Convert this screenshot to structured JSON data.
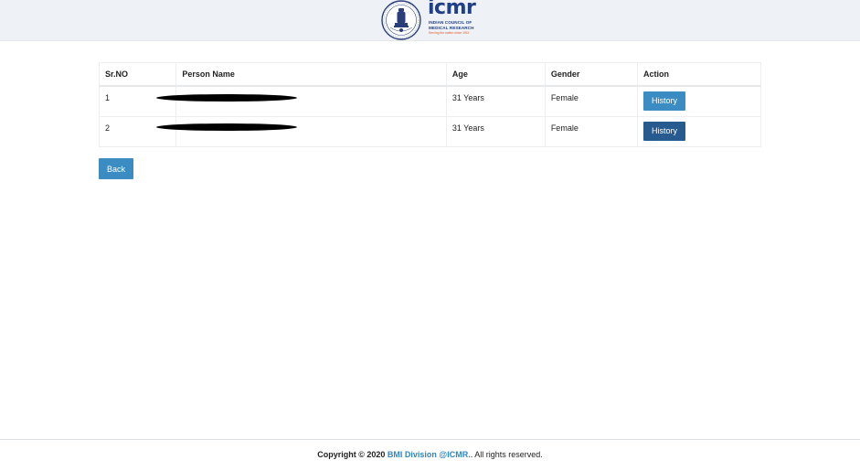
{
  "header": {
    "brand": "icmr",
    "brand_line1": "INDIAN COUNCIL OF",
    "brand_line2": "MEDICAL RESEARCH",
    "tagline": "Serving the nation since 1911",
    "emblem_icon": "icmr-emblem-icon"
  },
  "table": {
    "columns": [
      "Sr.NO",
      "Person Name",
      "Age",
      "Gender",
      "Action"
    ],
    "rows": [
      {
        "sr": "1",
        "name": "",
        "age": "31 Years",
        "gender": "Female",
        "action": "History"
      },
      {
        "sr": "2",
        "name": "",
        "age": "31 Years",
        "gender": "Female",
        "action": "History"
      }
    ]
  },
  "buttons": {
    "back": "Back"
  },
  "footer": {
    "prefix": "Copyright © 2020 ",
    "link": "BMI Division @ICMR.",
    "suffix": ". All rights reserved."
  },
  "colors": {
    "header_bg": "#eef1f5",
    "primary_button": "#3a8cc2",
    "active_button": "#275a8f",
    "link": "#2f86c4",
    "brand_blue": "#1f3f86",
    "brand_orange": "#f0602a"
  }
}
